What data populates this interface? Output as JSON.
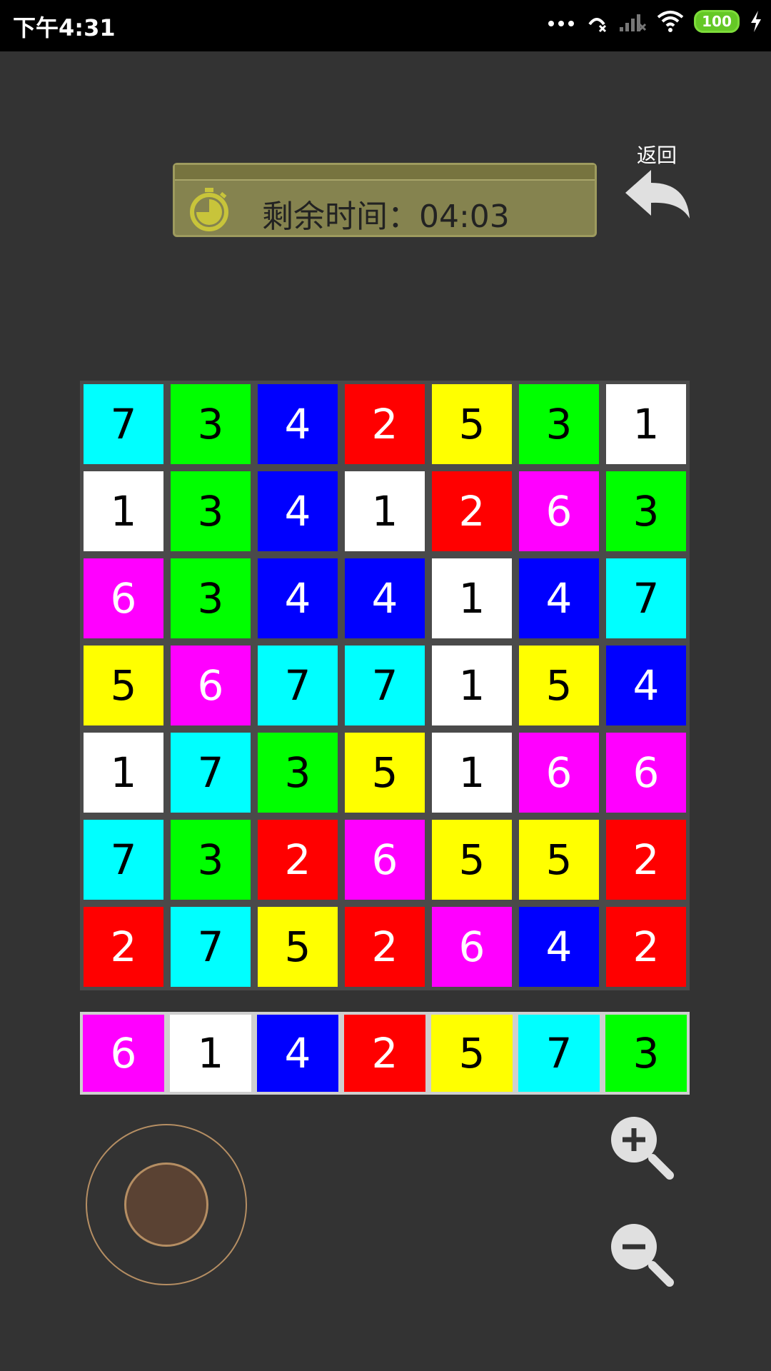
{
  "status_bar": {
    "time": "下午4:31",
    "battery": "100"
  },
  "timer": {
    "label": "剩余时间：04:03"
  },
  "back_button": {
    "label": "返回"
  },
  "colors": {
    "cyan": "#00ffff",
    "green": "#00ff00",
    "blue": "#0000ff",
    "red": "#ff0000",
    "yellow": "#ffff00",
    "white": "#ffffff",
    "magenta": "#ff00ff"
  },
  "board": [
    [
      {
        "n": "7",
        "c": "cyan"
      },
      {
        "n": "3",
        "c": "green"
      },
      {
        "n": "4",
        "c": "blue"
      },
      {
        "n": "2",
        "c": "red"
      },
      {
        "n": "5",
        "c": "yellow"
      },
      {
        "n": "3",
        "c": "green"
      },
      {
        "n": "1",
        "c": "white"
      }
    ],
    [
      {
        "n": "1",
        "c": "white"
      },
      {
        "n": "3",
        "c": "green"
      },
      {
        "n": "4",
        "c": "blue"
      },
      {
        "n": "1",
        "c": "white"
      },
      {
        "n": "2",
        "c": "red"
      },
      {
        "n": "6",
        "c": "magenta"
      },
      {
        "n": "3",
        "c": "green"
      }
    ],
    [
      {
        "n": "6",
        "c": "magenta"
      },
      {
        "n": "3",
        "c": "green"
      },
      {
        "n": "4",
        "c": "blue"
      },
      {
        "n": "4",
        "c": "blue"
      },
      {
        "n": "1",
        "c": "white"
      },
      {
        "n": "4",
        "c": "blue"
      },
      {
        "n": "7",
        "c": "cyan"
      }
    ],
    [
      {
        "n": "5",
        "c": "yellow"
      },
      {
        "n": "6",
        "c": "magenta"
      },
      {
        "n": "7",
        "c": "cyan"
      },
      {
        "n": "7",
        "c": "cyan"
      },
      {
        "n": "1",
        "c": "white"
      },
      {
        "n": "5",
        "c": "yellow"
      },
      {
        "n": "4",
        "c": "blue"
      }
    ],
    [
      {
        "n": "1",
        "c": "white"
      },
      {
        "n": "7",
        "c": "cyan"
      },
      {
        "n": "3",
        "c": "green"
      },
      {
        "n": "5",
        "c": "yellow"
      },
      {
        "n": "1",
        "c": "white"
      },
      {
        "n": "6",
        "c": "magenta"
      },
      {
        "n": "6",
        "c": "magenta"
      }
    ],
    [
      {
        "n": "7",
        "c": "cyan"
      },
      {
        "n": "3",
        "c": "green"
      },
      {
        "n": "2",
        "c": "red"
      },
      {
        "n": "6",
        "c": "magenta"
      },
      {
        "n": "5",
        "c": "yellow"
      },
      {
        "n": "5",
        "c": "yellow"
      },
      {
        "n": "2",
        "c": "red"
      }
    ],
    [
      {
        "n": "2",
        "c": "red"
      },
      {
        "n": "7",
        "c": "cyan"
      },
      {
        "n": "5",
        "c": "yellow"
      },
      {
        "n": "2",
        "c": "red"
      },
      {
        "n": "6",
        "c": "magenta"
      },
      {
        "n": "4",
        "c": "blue"
      },
      {
        "n": "2",
        "c": "red"
      }
    ]
  ],
  "palette": [
    {
      "n": "6",
      "c": "magenta"
    },
    {
      "n": "1",
      "c": "white"
    },
    {
      "n": "4",
      "c": "blue"
    },
    {
      "n": "2",
      "c": "red"
    },
    {
      "n": "5",
      "c": "yellow"
    },
    {
      "n": "7",
      "c": "cyan"
    },
    {
      "n": "3",
      "c": "green"
    }
  ],
  "icons": {
    "timer": "stopwatch-icon",
    "back": "back-arrow-icon",
    "zoom_in": "zoom-in-icon",
    "zoom_out": "zoom-out-icon"
  }
}
